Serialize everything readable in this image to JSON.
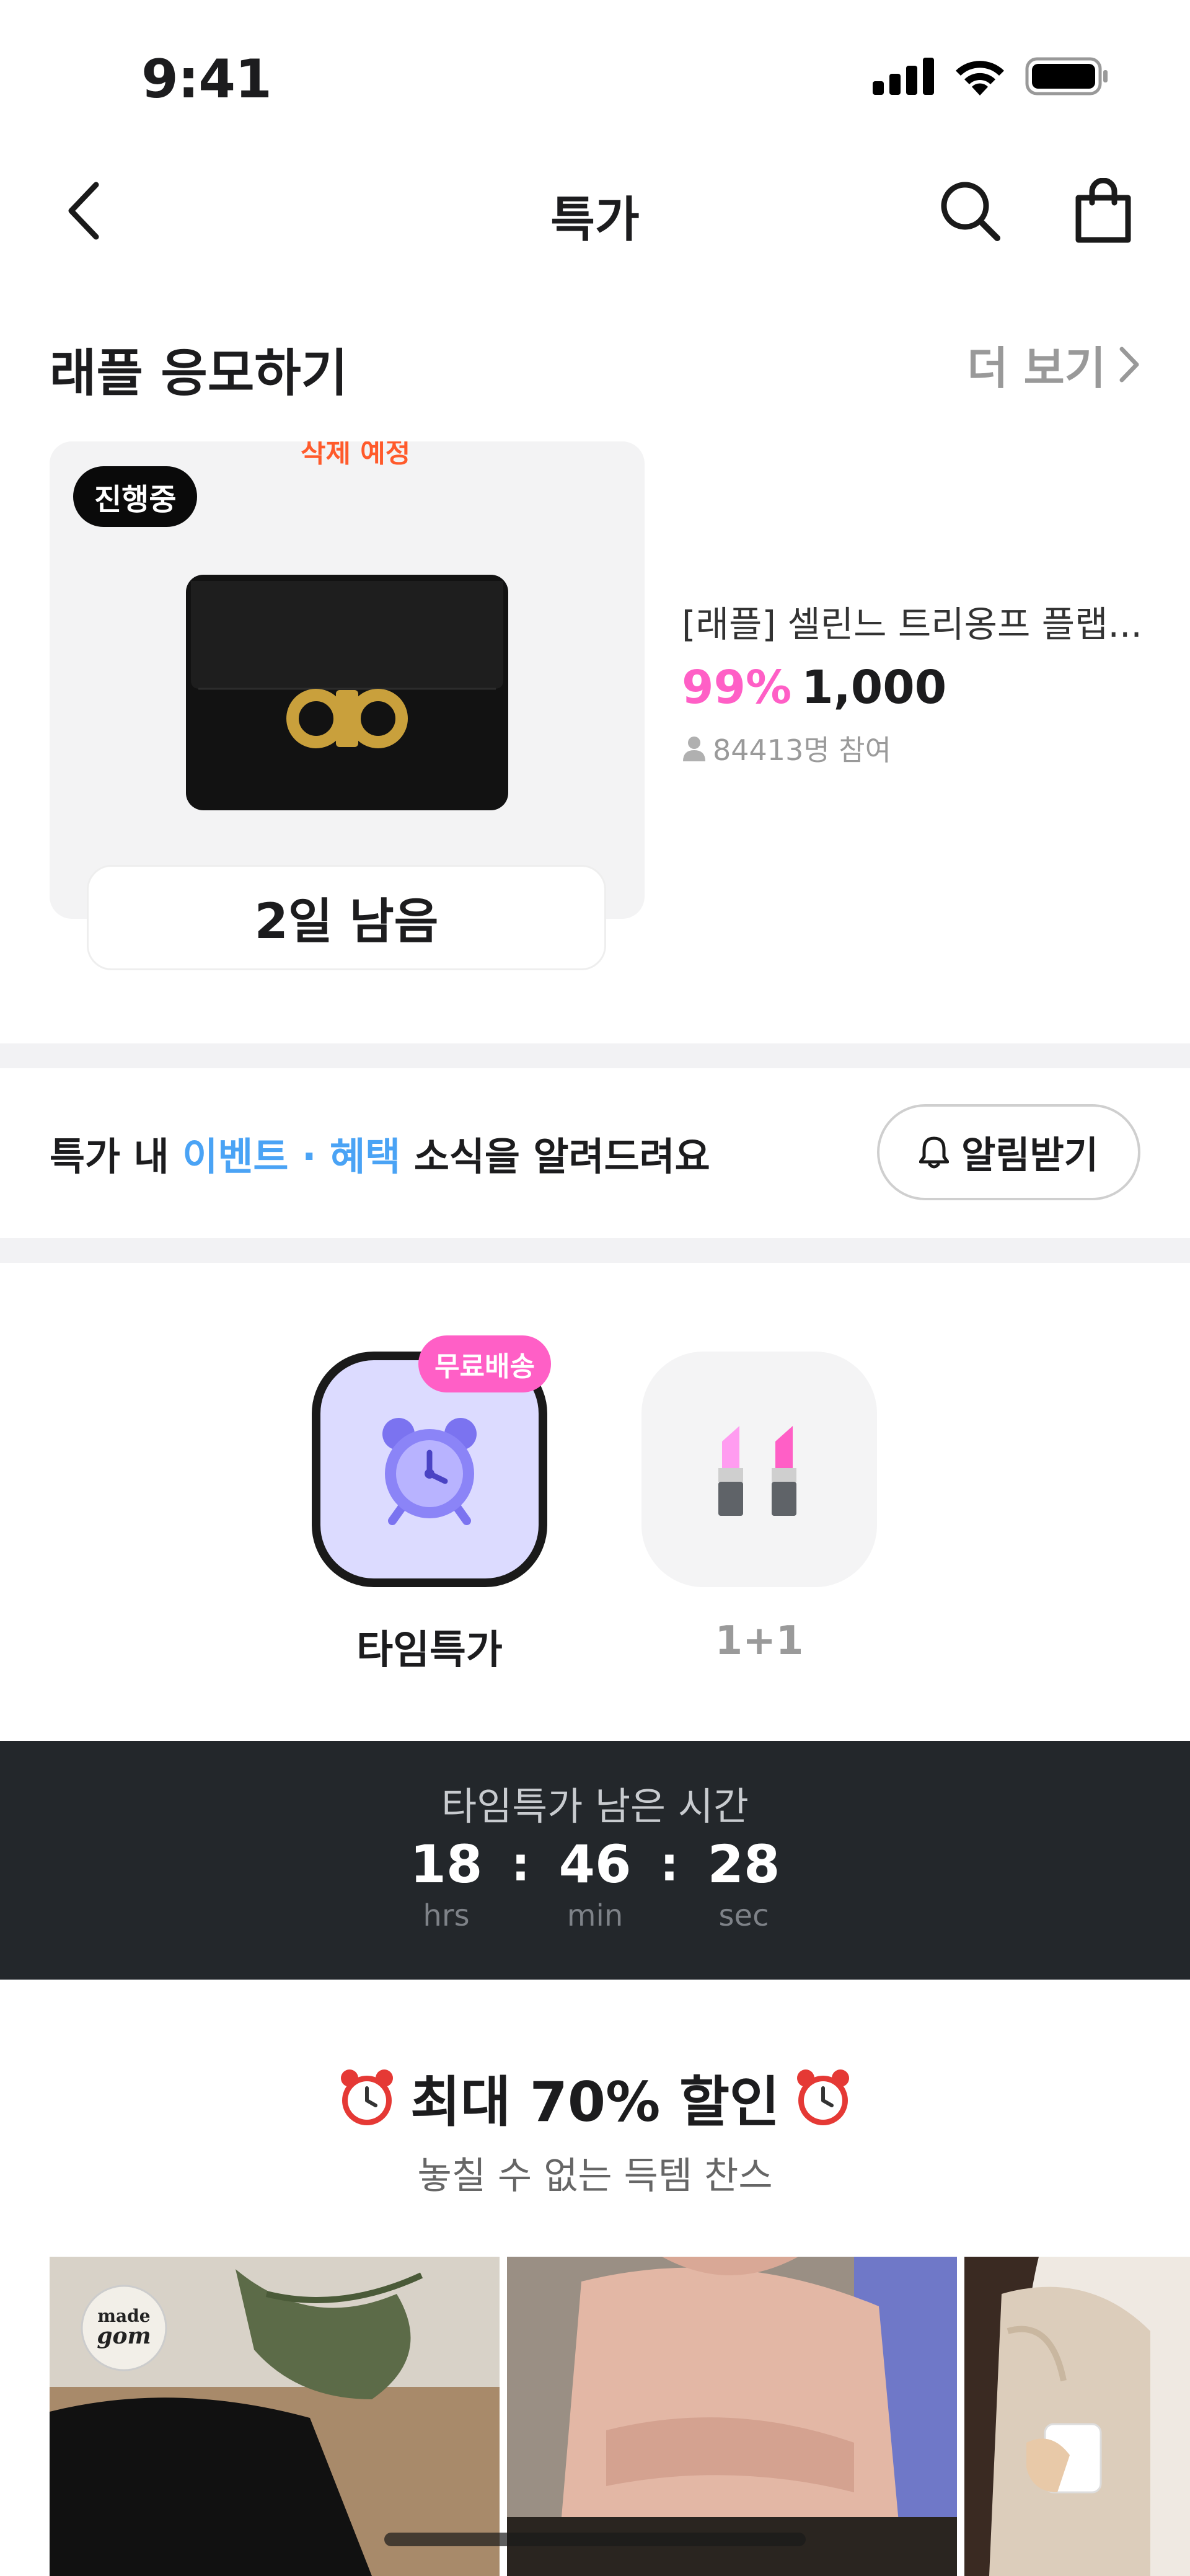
{
  "status_bar": {
    "time": "9:41"
  },
  "nav": {
    "title": "특가"
  },
  "raffle": {
    "section_title": "래플 응모하기",
    "more_label": "더 보기",
    "badge": "진행중",
    "top_text": "삭제 예정",
    "days_left": "2일 남음",
    "product_name": "[래플] 셀린느 트리옹프 플랩...",
    "discount": "99%",
    "price": "1,000",
    "participants": "84413명 참여"
  },
  "notify": {
    "text_prefix": "특가 내 ",
    "text_highlight": "이벤트 · 혜택",
    "text_suffix": " 소식을 알려드려요",
    "button_label": "알림받기"
  },
  "categories": [
    {
      "label": "타임특가",
      "badge": "무료배송",
      "icon": "alarm-clock-icon",
      "active": true
    },
    {
      "label": "1+1",
      "icon": "lipstick-icon",
      "active": false
    }
  ],
  "timer": {
    "title": "타임특가 남은 시간",
    "hours": "18",
    "hours_label": "hrs",
    "minutes": "46",
    "minutes_label": "min",
    "seconds": "28",
    "seconds_label": "sec",
    "separator": ":"
  },
  "promo": {
    "title": "최대 70% 할인",
    "subtitle": "놓칠 수 없는 득템 찬스"
  },
  "products": [
    {
      "image": "black-skirt-bouquet",
      "logo_line1": "made",
      "logo_line2": "gom"
    },
    {
      "image": "pink-knit-sweater"
    },
    {
      "image": "beige-cardigan-mug"
    }
  ],
  "colors": {
    "accent_pink": "#ff5fc6",
    "accent_blue": "#4aa3f5",
    "timer_bg": "#23272b",
    "active_tile": "#dcdbff"
  }
}
